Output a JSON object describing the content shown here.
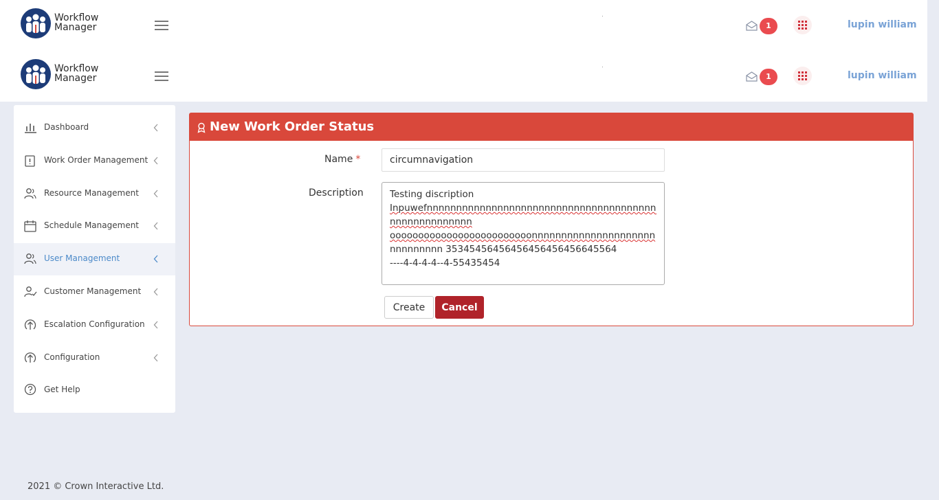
{
  "app": {
    "logo_line1": "Workflow",
    "logo_line2": "Manager",
    "notification_count": "1",
    "username": "lupin william"
  },
  "sidebar": {
    "items": [
      {
        "label": "Dashboard",
        "icon": "bar-chart-icon",
        "active": false,
        "chevron": true
      },
      {
        "label": "Work Order Management",
        "icon": "clipboard-alert-icon",
        "active": false,
        "chevron": true
      },
      {
        "label": "Resource Management",
        "icon": "users-icon",
        "active": false,
        "chevron": true
      },
      {
        "label": "Schedule Management",
        "icon": "calendar-icon",
        "active": false,
        "chevron": true
      },
      {
        "label": "User Management",
        "icon": "users-icon",
        "active": true,
        "chevron": true
      },
      {
        "label": "Customer Management",
        "icon": "user-check-icon",
        "active": false,
        "chevron": true
      },
      {
        "label": "Escalation Configuration",
        "icon": "arrow-up-circle-icon",
        "active": false,
        "chevron": true
      },
      {
        "label": "Configuration",
        "icon": "arrow-up-circle-icon",
        "active": false,
        "chevron": true
      },
      {
        "label": "Get Help",
        "icon": "help-circle-icon",
        "active": false,
        "chevron": false
      }
    ]
  },
  "form": {
    "title": "New Work Order Status",
    "name_label": "Name",
    "required_mark": "*",
    "name_value": "circumnavigation",
    "description_label": "Description",
    "description_lines": [
      "Testing discription",
      "Inpuwefnnnnnnnnnnnnnnnnnnnnnnnnnnnnnnnnnnnnnnnn",
      "nnnnnnnnnnnnnn",
      "ooooooooooooooooooooooooonnnnnnnnnnnnnnnnnnnnn",
      "nnnnnnnnn 35345456456456456456456645564",
      "----4-4-4-4--4-55435454"
    ],
    "create_label": "Create",
    "cancel_label": "Cancel"
  },
  "footer": {
    "text": "2021 © Crown Interactive Ltd."
  },
  "colors": {
    "brand_red": "#d9483b",
    "cancel_red": "#b0232a",
    "badge_red": "#ea4b4f",
    "link_blue": "#7aa3d6",
    "active_blue": "#4c8ac9",
    "logo_navy": "#1d3c78"
  }
}
